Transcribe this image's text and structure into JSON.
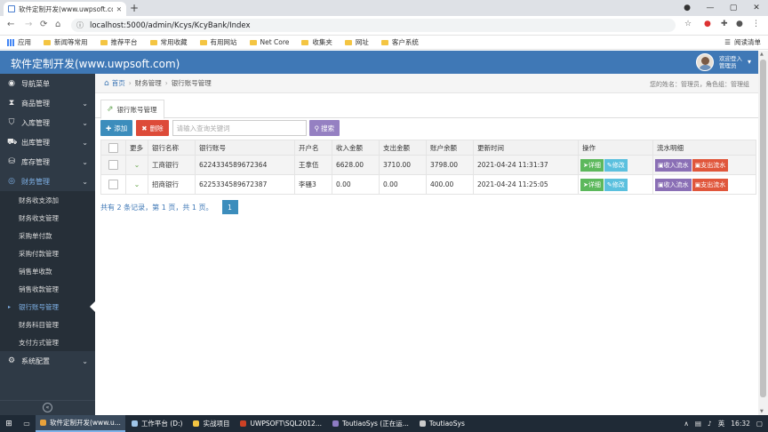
{
  "browser": {
    "tab_title": "软件定制开发(www.uwpsoft.co",
    "url": "localhost:5000/admin/Kcys/KcyBank/Index",
    "bookmarks": [
      "应用",
      "新闻等常用",
      "推荐平台",
      "常用收藏",
      "有用网站",
      "Net Core",
      "收集夹",
      "网址",
      "客户系统"
    ],
    "reading_list": "阅读清单"
  },
  "header": {
    "brand": "软件定制开发(www.uwpsoft.com)",
    "welcome": "欢迎登入",
    "username": "管理员"
  },
  "sidebar": {
    "items": [
      {
        "label": "导航菜单",
        "icon": "dashboard-icon"
      },
      {
        "label": "商品管理",
        "icon": "goods-icon"
      },
      {
        "label": "入库管理",
        "icon": "inbound-icon"
      },
      {
        "label": "出库管理",
        "icon": "outbound-icon"
      },
      {
        "label": "库存管理",
        "icon": "inventory-icon"
      },
      {
        "label": "财务管理",
        "icon": "finance-icon"
      }
    ],
    "sub_items": [
      "财务收支添加",
      "财务收支管理",
      "采购单付款",
      "采购付款管理",
      "销售单收款",
      "销售收款管理",
      "银行账号管理",
      "财务科目管理",
      "支付方式管理"
    ],
    "bottom_item": "系统配置"
  },
  "breadcrumb": {
    "home": "首页",
    "level1": "财务管理",
    "level2": "银行账号管理",
    "info": "您的姓名：管理员，角色组：管理组"
  },
  "page_tab": "银行账号管理",
  "toolbar": {
    "add": "添加",
    "delete": "删除",
    "search_placeholder": "请输入查询关键词",
    "search": "搜索"
  },
  "table": {
    "headers": [
      "更多",
      "银行名称",
      "银行账号",
      "开户名",
      "收入金额",
      "支出金额",
      "账户余额",
      "更新时间",
      "操作",
      "流水明细"
    ],
    "rows": [
      {
        "bank": "工商银行",
        "account": "6224334589672364",
        "owner": "王拿伍",
        "income": "6628.00",
        "expense": "3710.00",
        "balance": "3798.00",
        "updated": "2021-04-24 11:31:37"
      },
      {
        "bank": "招商银行",
        "account": "6225334589672387",
        "owner": "李骚3",
        "income": "0.00",
        "expense": "0.00",
        "balance": "400.00",
        "updated": "2021-04-24 11:25:05"
      }
    ],
    "btn_detail": "详细",
    "btn_edit": "修改",
    "btn_income_flow": "收入流水",
    "btn_expense_flow": "支出流水"
  },
  "pager": {
    "summary": "共有 2 条记录，第 1 页，共 1 页。",
    "page": "1"
  },
  "taskbar": {
    "items": [
      "软件定制开发(www.u...",
      "工作平台 (D:)",
      "实战项目",
      "UWPSOFT\\SQL2012...",
      "ToutiaoSys (正在运...",
      "ToutiaoSys"
    ],
    "time": "16:32",
    "ime": "英"
  }
}
